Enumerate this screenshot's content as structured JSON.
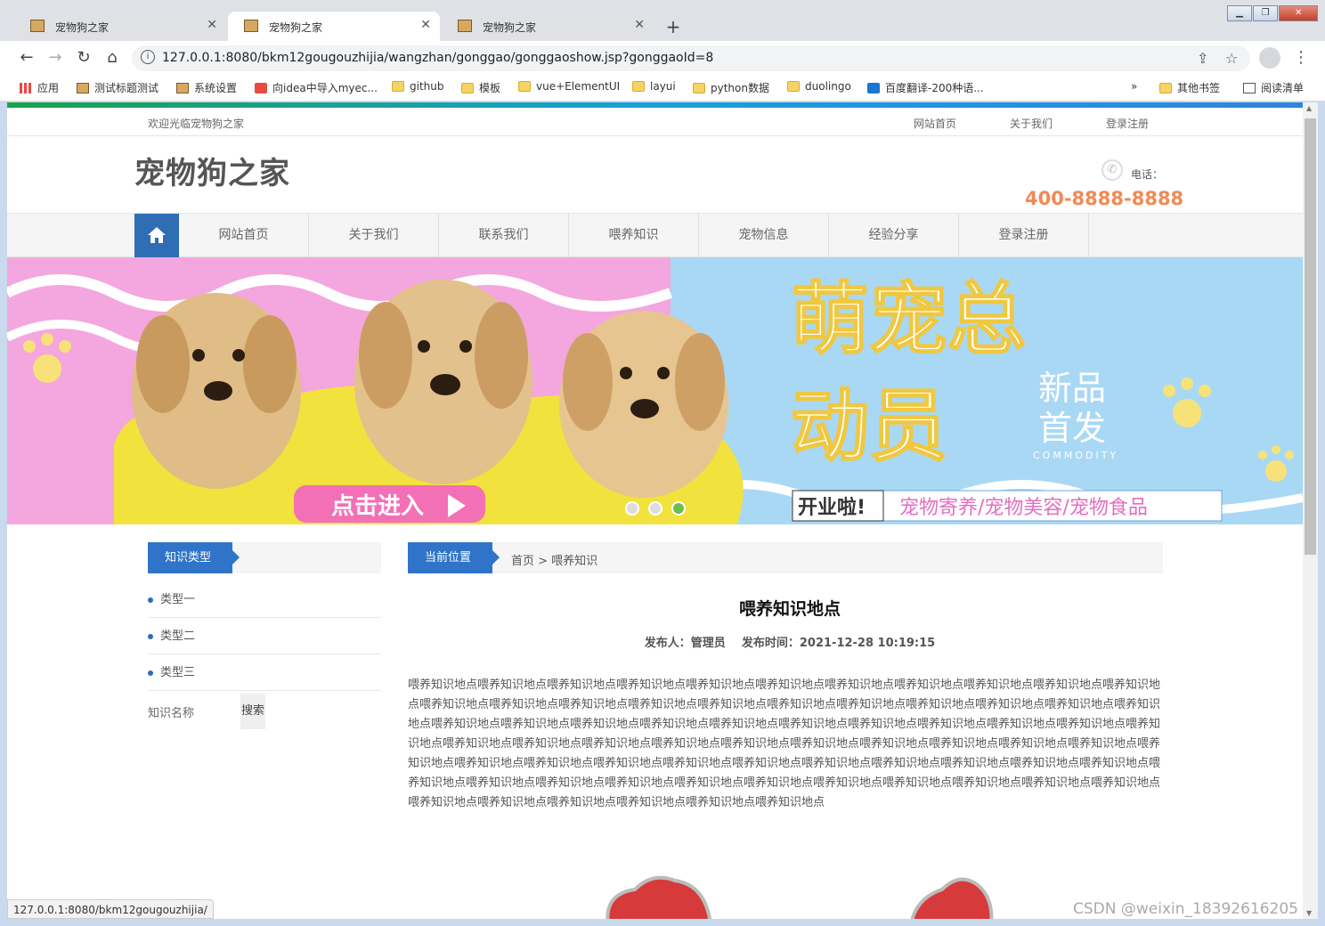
{
  "browser": {
    "tabs": [
      {
        "title": "宠物狗之家",
        "active": false
      },
      {
        "title": "宠物狗之家",
        "active": true
      },
      {
        "title": "宠物狗之家",
        "active": false
      }
    ],
    "new_tab": "+",
    "url": "127.0.0.1:8080/bkm12gougouzhijia/wangzhan/gonggao/gonggaoshow.jsp?gonggaoId=8",
    "bookmarks": [
      {
        "label": "应用",
        "icon": "apps-icon"
      },
      {
        "label": "测试标题测试",
        "icon": "picture-icon"
      },
      {
        "label": "系统设置",
        "icon": "picture-icon"
      },
      {
        "label": "向idea中导入myec...",
        "icon": "c-logo-icon"
      },
      {
        "label": "github",
        "icon": "folder-icon"
      },
      {
        "label": "模板",
        "icon": "folder-icon"
      },
      {
        "label": "vue+ElementUI",
        "icon": "folder-icon"
      },
      {
        "label": "layui",
        "icon": "folder-icon"
      },
      {
        "label": "python数据",
        "icon": "folder-icon"
      },
      {
        "label": "duolingo",
        "icon": "folder-icon"
      },
      {
        "label": "百度翻译-200种语...",
        "icon": "translate-icon"
      }
    ],
    "more_bookmarks": "»",
    "other_bookmarks": "其他书签",
    "reading_list": "阅读清单",
    "status_url": "127.0.0.1:8080/bkm12gougouzhijia/"
  },
  "site": {
    "welcome": "欢迎光临宠物狗之家",
    "top_links": [
      "网站首页",
      "关于我们",
      "登录注册"
    ],
    "logo": "宠物狗之家",
    "phone_label": "电话：",
    "phone_number": "400-8888-8888",
    "nav": [
      "网站首页",
      "关于我们",
      "联系我们",
      "喂养知识",
      "宠物信息",
      "经验分享",
      "登录注册"
    ],
    "colors": {
      "primary": "#2f6db5",
      "accent": "#f08a55"
    }
  },
  "banner": {
    "cta": "点击进入",
    "headline_lines": [
      "萌宠总",
      "动员"
    ],
    "side_lines": [
      "新品",
      "首发"
    ],
    "commodity": "COMMODITY",
    "open_tag": "开业啦!",
    "services": "宠物寄养/宠物美容/宠物食品",
    "slides": 3,
    "active_slide": 3
  },
  "sidebar": {
    "title": "知识类型",
    "items": [
      "类型一",
      "类型二",
      "类型三"
    ],
    "search_label": "知识名称",
    "search_button": "搜索"
  },
  "breadcrumb": {
    "title": "当前位置",
    "path": "首页 > 喂养知识"
  },
  "article": {
    "title": "喂养知识地点",
    "meta": "发布人：管理员    发布时间：2021-12-28 10:19:15",
    "body": "喂养知识地点喂养知识地点喂养知识地点喂养知识地点喂养知识地点喂养知识地点喂养知识地点喂养知识地点喂养知识地点喂养知识地点喂养知识地点喂养知识地点喂养知识地点喂养知识地点喂养知识地点喂养知识地点喂养知识地点喂养知识地点喂养知识地点喂养知识地点喂养知识地点喂养知识地点喂养知识地点喂养知识地点喂养知识地点喂养知识地点喂养知识地点喂养知识地点喂养知识地点喂养知识地点喂养知识地点喂养知识地点喂养知识地点喂养知识地点喂养知识地点喂养知识地点喂养知识地点喂养知识地点喂养知识地点喂养知识地点喂养知识地点喂养知识地点喂养知识地点喂养知识地点喂养知识地点喂养知识地点喂养知识地点喂养知识地点喂养知识地点喂养知识地点喂养知识地点喂养知识地点喂养知识地点喂养知识地点喂养知识地点喂养知识地点喂养知识地点喂养知识地点喂养知识地点喂养知识地点喂养知识地点喂养知识地点喂养知识地点喂养知识地点喂养知识地点喂养知识地点喂养知识地点喂养知识地点喂养知识地点喂养知识地点喂养知识地点"
  },
  "watermark": "CSDN @weixin_18392616205"
}
